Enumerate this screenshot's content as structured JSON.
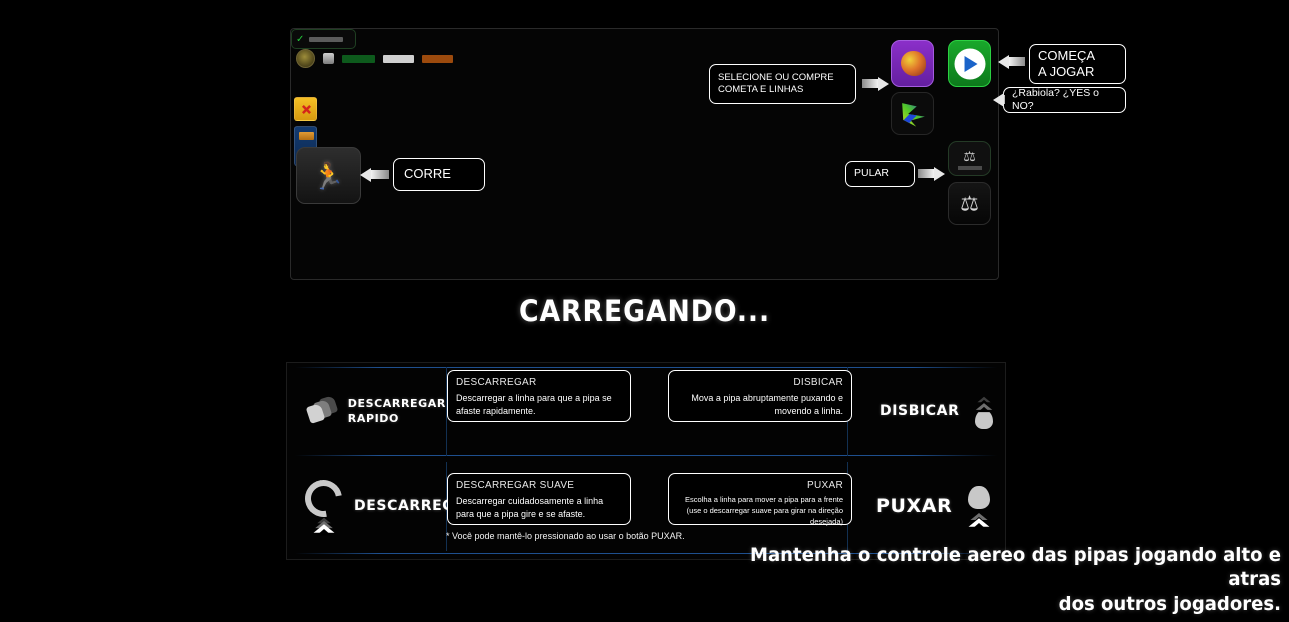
{
  "loading": {
    "title": "CARREGANDO..."
  },
  "top_panel": {
    "hud": {
      "avatar_icon": "player-avatar-icon",
      "coin_icon": "coin-icon",
      "stat_green": "",
      "stat_gray": "",
      "stat_orange": ""
    },
    "buttons": {
      "shop_icon": "kite-shop-icon",
      "play_icon": "play-icon",
      "kite_select_icon": "kite-select-icon",
      "verified_icon": "check-icon",
      "verified_label": "",
      "store_icon": "store-icon",
      "store_label": "",
      "jump_icon": "jump-icon",
      "run_icon": "run-icon"
    },
    "callouts": {
      "select_buy": "SELECIONE OU COMPRE\nCOMETA E LINHAS",
      "select_buy_line1": "SELECIONE OU COMPRE",
      "select_buy_line2": "COMETA E LINHAS",
      "start_playing_line1": "COMEÇA",
      "start_playing_line2": "A JOGAR",
      "rabiola": "¿Rabiola? ¿YES o NO?",
      "run": "CORRE",
      "jump": "PULAR"
    }
  },
  "controls": {
    "rows": [
      {
        "left_cell": {
          "label_line1": "DESCARREGAR",
          "label_line2": "RAPIDO",
          "icon": "swipe-fast-icon"
        },
        "tooltip_left": {
          "title": "DESCARREGAR",
          "body": "Descarregar a linha para que a pipa se afaste rapidamente."
        },
        "tooltip_right": {
          "title": "DISBICAR",
          "body": "Mova a pipa abruptamente puxando e movendo a linha."
        },
        "right_cell": {
          "label": "DISBICAR",
          "icon": "flick-up-icon"
        }
      },
      {
        "left_cell": {
          "label_line1": "DESCARREGAR",
          "label_line2": "",
          "icon": "release-loop-icon"
        },
        "tooltip_left": {
          "title": "DESCARREGAR SUAVE",
          "body": "Descarregar cuidadosamente a linha para que a pipa gire e se afaste."
        },
        "tooltip_right": {
          "title": "PUXAR",
          "body": "Escolha a linha para mover a pipa para a frente (use o descarregar suave para girar na direção desejada)"
        },
        "right_cell": {
          "label": "PUXAR",
          "icon": "pull-up-icon"
        }
      }
    ],
    "footnote": "* Você pode mantê-lo pressionado ao usar o botão PUXAR."
  },
  "caption": {
    "line1": "Mantenha o controle aereo das pipas jogando alto e atras",
    "line2": "dos outros jogadores."
  },
  "colors": {
    "accent_blue": "#1e4f8e",
    "play_green": "#19a82b",
    "shop_purple": "#8b2fc9",
    "card_yellow": "#f5c024",
    "card_blue": "#123a70"
  }
}
